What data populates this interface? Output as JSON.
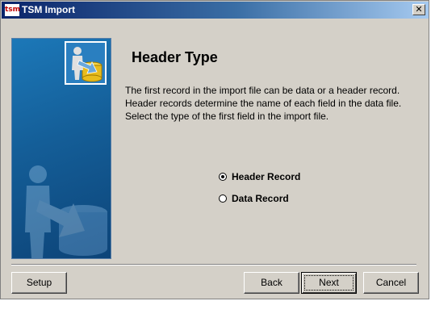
{
  "window": {
    "title": "TSM Import",
    "icon_text": "tsm",
    "close_label": "✕"
  },
  "main": {
    "heading": "Header Type",
    "description": "The first record in the import file can be data or a header record. Header records determine the name of each field in the data file. Select the type of the first field in the import file.",
    "options": [
      {
        "label": "Header Record",
        "checked": true
      },
      {
        "label": "Data Record",
        "checked": false
      }
    ]
  },
  "buttons": {
    "setup": "Setup",
    "back": "Back",
    "next": "Next",
    "cancel": "Cancel"
  },
  "colors": {
    "titlebar_start": "#0a246a",
    "titlebar_end": "#a6caf0",
    "dialog_bg": "#d4d0c8",
    "panel_blue": "#145e98"
  },
  "icons": {
    "title": "tsm-app-icon",
    "panel_logo": "user-import-database-icon",
    "panel_art": "user-arrow-database-icon"
  }
}
